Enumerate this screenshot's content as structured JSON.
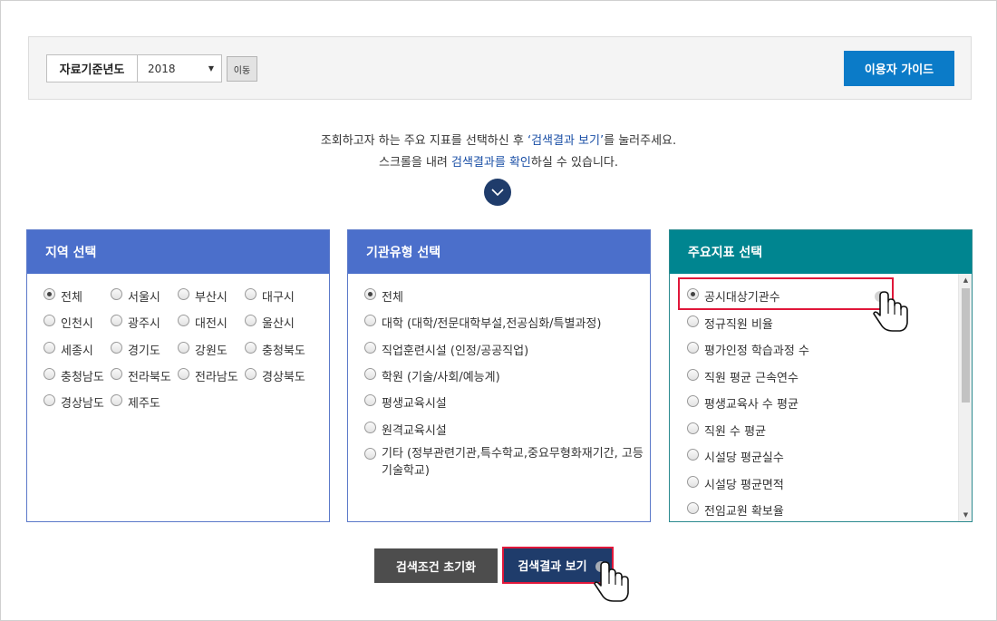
{
  "toolbar": {
    "year_label": "자료기준년도",
    "year_value": "2018",
    "move_label": "이동",
    "guide_label": "이용자 가이드"
  },
  "instructions": {
    "line1_a": "조회하고자 하는 주요 지표를 선택하신 후 ",
    "line1_hl": "‘검색결과 보기’",
    "line1_b": "를 눌러주세요.",
    "line2_a": "스크롤을 내려 ",
    "line2_hl": "검색결과를 확인",
    "line2_b": "하실 수 있습니다."
  },
  "region": {
    "title": "지역 선택",
    "options": [
      "전체",
      "서울시",
      "부산시",
      "대구시",
      "인천시",
      "광주시",
      "대전시",
      "울산시",
      "세종시",
      "경기도",
      "강원도",
      "충청북도",
      "충청남도",
      "전라북도",
      "전라남도",
      "경상북도",
      "경상남도",
      "제주도"
    ],
    "selected": "전체"
  },
  "institution": {
    "title": "기관유형 선택",
    "options": [
      "전체",
      "대학 (대학/전문대학부설,전공심화/특별과정)",
      "직업훈련시설 (인정/공공직업)",
      "학원 (기술/사회/예능계)",
      "평생교육시설",
      "원격교육시설",
      "기타 (정부관련기관,특수학교,중요무형화재기간, 고등기술학교)"
    ],
    "selected": "전체"
  },
  "indicator": {
    "title": "주요지표 선택",
    "options": [
      "공시대상기관수",
      "정규직원 비율",
      "평가인정 학습과정 수",
      "직원 평균 근속연수",
      "평생교육사 수 평균",
      "직원 수 평균",
      "시설당 평균실수",
      "시설당 평균면적",
      "전임교원 확보율"
    ],
    "selected": "공시대상기관수"
  },
  "actions": {
    "reset_label": "검색조건 초기화",
    "search_label": "검색결과 보기"
  },
  "colors": {
    "accent_blue": "#4b6fcb",
    "teal": "#008590",
    "navy": "#1f3c6b",
    "highlight_red": "#e0173a",
    "guide_blue": "#0b7bc8"
  }
}
